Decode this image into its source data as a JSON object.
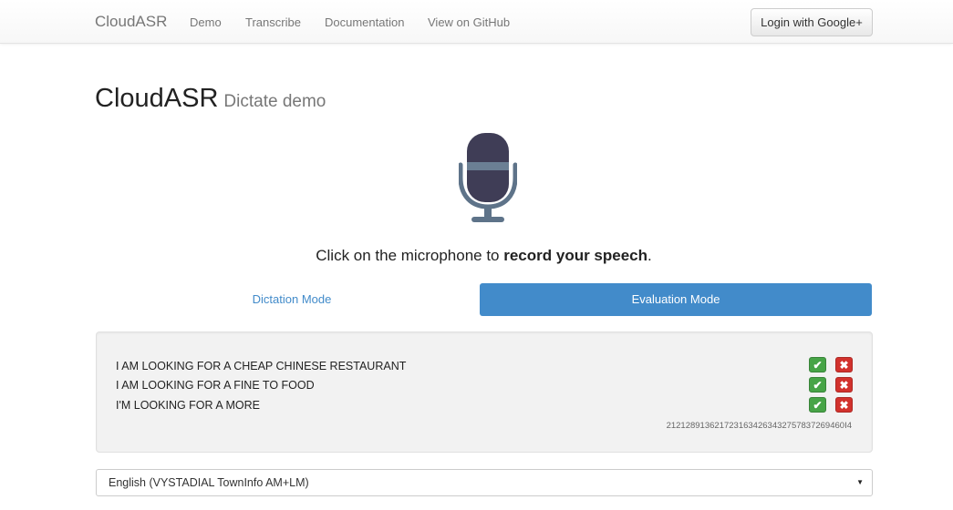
{
  "navbar": {
    "brand": "CloudASR",
    "links": [
      "Demo",
      "Transcribe",
      "Documentation",
      "View on GitHub"
    ],
    "login_label": "Login with Google+"
  },
  "header": {
    "title": "CloudASR",
    "subtitle": "Dictate demo"
  },
  "microphone": {
    "icon": "microphone-icon"
  },
  "instruction": {
    "prefix": "Click on the microphone to ",
    "emphasis": "record your speech",
    "suffix": "."
  },
  "modes": {
    "dictation": "Dictation Mode",
    "evaluation": "Evaluation Mode",
    "active": "evaluation"
  },
  "results": {
    "hypotheses": [
      "I AM LOOKING FOR A CHEAP CHINESE RESTAURANT",
      "I AM LOOKING FOR A FINE TO FOOD",
      "I'M LOOKING FOR A MORE"
    ],
    "accept_icon": "check-icon",
    "reject_icon": "x-icon",
    "id": "2121289136217231634263432757837269460I4"
  },
  "language": {
    "selected": "English (VYSTADIAL TownInfo AM+LM)"
  },
  "colors": {
    "primary": "#428bca",
    "accept": "#47a447",
    "reject": "#d2322d",
    "mic_body": "#3f3d56",
    "mic_stand": "#5e7389"
  }
}
